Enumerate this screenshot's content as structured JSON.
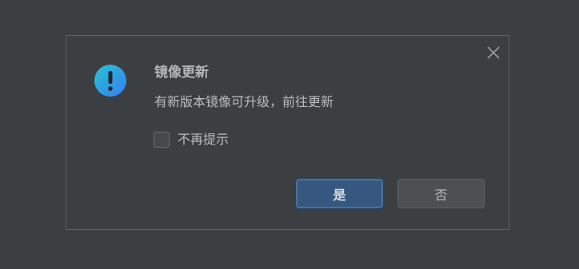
{
  "dialog": {
    "title": "镜像更新",
    "message": "有新版本镜像可升级，前往更新",
    "checkbox_label": "不再提示",
    "checkbox_checked": false,
    "yes_label": "是",
    "no_label": "否",
    "icons": {
      "status": "info-exclamation-icon",
      "close": "close-icon"
    },
    "colors": {
      "background": "#3c3f41",
      "accent_button": "#365880",
      "icon_gradient_start": "#23c6d9",
      "icon_gradient_end": "#3a7bf0"
    }
  }
}
